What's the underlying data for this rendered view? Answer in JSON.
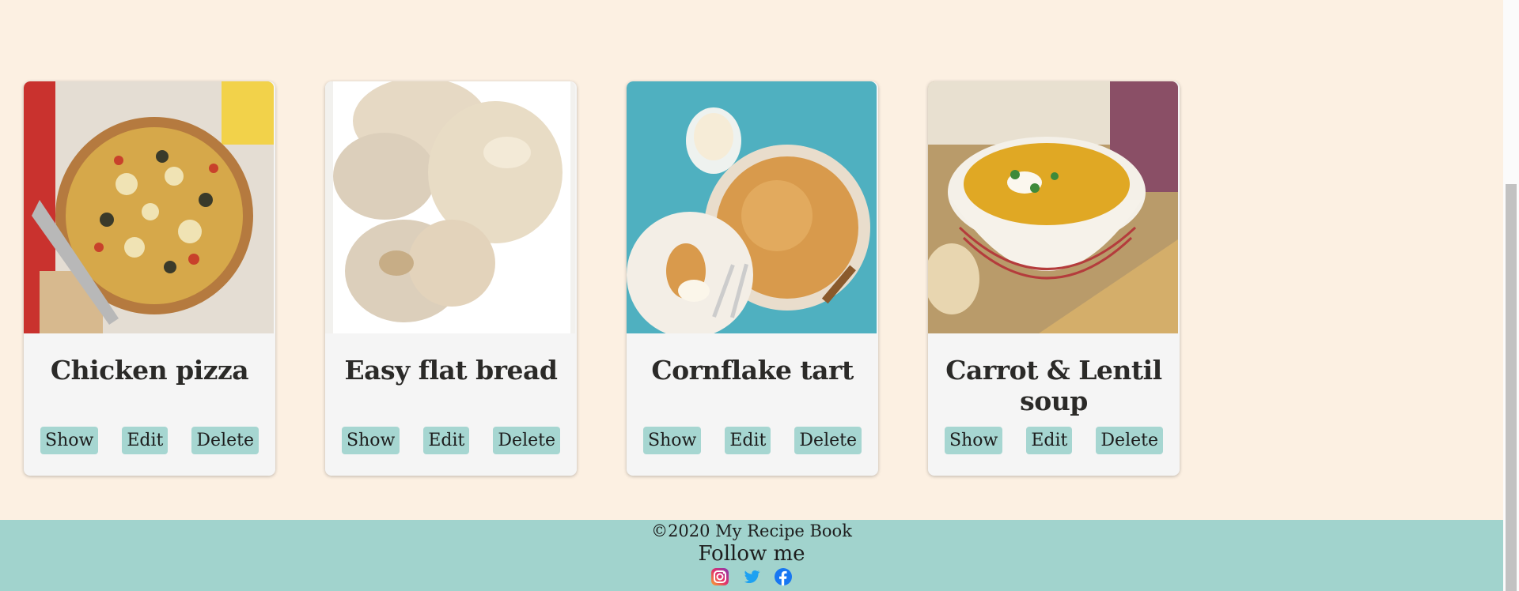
{
  "recipes": [
    {
      "title": "Chicken pizza",
      "show": "Show",
      "edit": "Edit",
      "delete": "Delete"
    },
    {
      "title": "Easy flat bread",
      "show": "Show",
      "edit": "Edit",
      "delete": "Delete"
    },
    {
      "title": "Cornflake tart",
      "show": "Show",
      "edit": "Edit",
      "delete": "Delete"
    },
    {
      "title": "Carrot & Lentil soup",
      "show": "Show",
      "edit": "Edit",
      "delete": "Delete"
    }
  ],
  "footer": {
    "copyright": "©2020 My Recipe Book",
    "follow": "Follow me",
    "socials": [
      "instagram-icon",
      "twitter-icon",
      "facebook-icon"
    ]
  },
  "colors": {
    "background": "#fcf0e2",
    "card": "#f5f5f5",
    "button": "#a6d6d1",
    "footer": "#a1d3cd"
  }
}
